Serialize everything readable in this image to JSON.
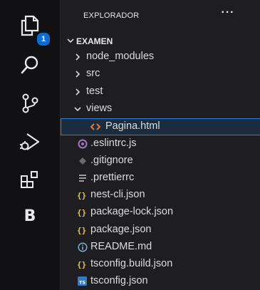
{
  "explorer": {
    "title": "EXPLORADOR",
    "more_label": "···",
    "root_folder": "EXAMEN"
  },
  "activity_bar": {
    "explorer_badge": "1",
    "extension_letter": "B",
    "items": [
      "files-icon",
      "search-icon",
      "source-control-icon",
      "run-debug-icon",
      "extensions-icon",
      "b-extension-icon"
    ]
  },
  "tree": {
    "node_modules": "node_modules",
    "src": "src",
    "test": "test",
    "views": "views",
    "pagina": "Pagina.html",
    "eslintrc": ".eslintrc.js",
    "gitignore": ".gitignore",
    "prettierrc": ".prettierrc",
    "nest_cli": "nest-cli.json",
    "package_lock": "package-lock.json",
    "package": "package.json",
    "readme": "README.md",
    "tsconfig_build": "tsconfig.build.json",
    "tsconfig": "tsconfig.json"
  },
  "colors": {
    "json": "#e8c547",
    "html": "#e37933",
    "eslint": "#a074c4",
    "info": "#519aba",
    "ts": "#3178c6",
    "badge": "#0d6cd1"
  }
}
